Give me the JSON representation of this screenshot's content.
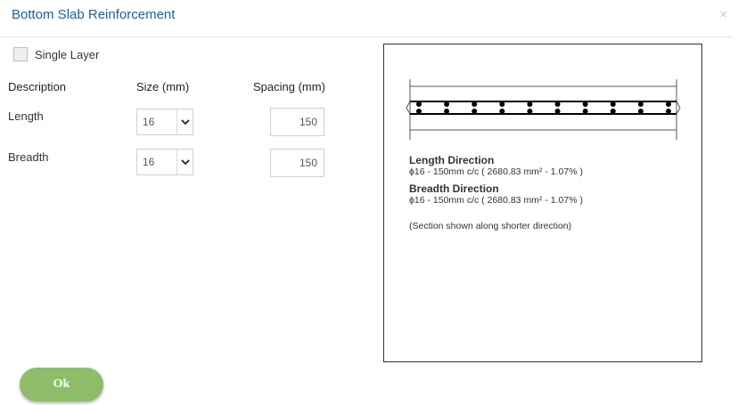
{
  "dialog": {
    "title": "Bottom Slab Reinforcement",
    "close_glyph": "×"
  },
  "single_layer": {
    "label": "Single Layer",
    "checked": false
  },
  "table": {
    "headers": {
      "description": "Description",
      "size": "Size (mm)",
      "spacing": "Spacing (mm)"
    },
    "rows": [
      {
        "label": "Length",
        "size": "16",
        "spacing": "150"
      },
      {
        "label": "Breadth",
        "size": "16",
        "spacing": "150"
      }
    ]
  },
  "preview": {
    "bar_count": 10,
    "length_title": "Length Direction",
    "length_detail": "ϕ16 - 150mm c/c ( 2680.83 mm² - 1.07% )",
    "breadth_title": "Breadth Direction",
    "breadth_detail": "ϕ16 - 150mm c/c ( 2680.83 mm² - 1.07% )",
    "note": "(Section shown along shorter direction)"
  },
  "footer": {
    "ok_label": "Ok"
  },
  "colors": {
    "title": "#1f5f99",
    "ok_button": "#8ebc6a"
  },
  "icons": {
    "close": "close-icon",
    "dropdown": "chevron-down-icon"
  }
}
